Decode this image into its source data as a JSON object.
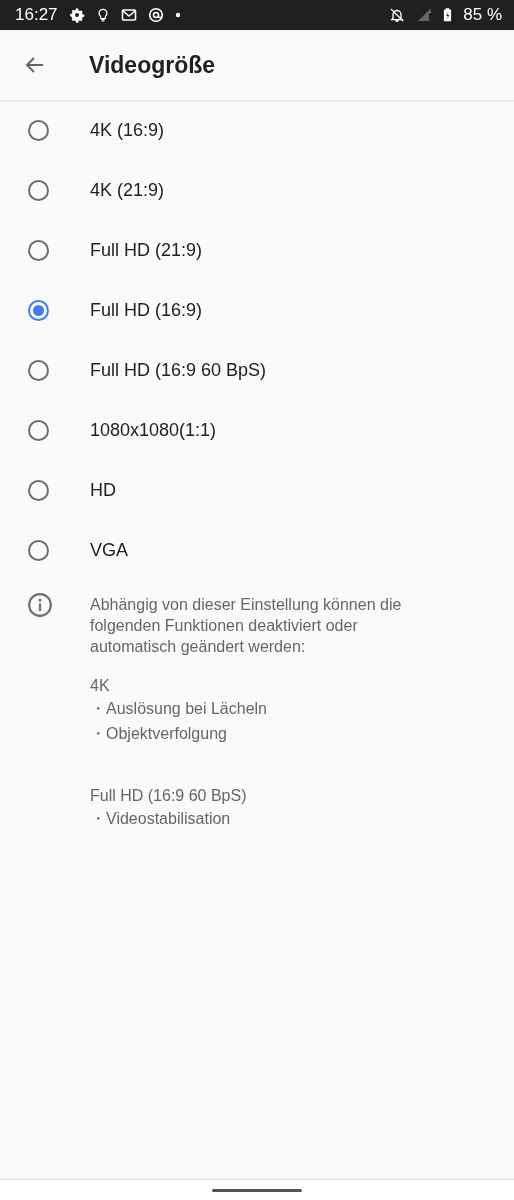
{
  "status_bar": {
    "time": "16:27",
    "battery": "85 %"
  },
  "app_bar": {
    "title": "Videogröße"
  },
  "options": [
    {
      "label": "4K (16:9)",
      "selected": false
    },
    {
      "label": "4K (21:9)",
      "selected": false
    },
    {
      "label": "Full HD (21:9)",
      "selected": false
    },
    {
      "label": "Full HD (16:9)",
      "selected": true
    },
    {
      "label": "Full HD (16:9 60 BpS)",
      "selected": false
    },
    {
      "label": "1080x1080(1:1)",
      "selected": false
    },
    {
      "label": "HD",
      "selected": false
    },
    {
      "label": "VGA",
      "selected": false
    }
  ],
  "info": {
    "text": "Abhängig von dieser Einstellung können die folgenden Funktionen deaktiviert oder automatisch geändert werden:",
    "groups": [
      {
        "heading": "4K",
        "items": [
          "・Auslösung bei Lächeln",
          "・Objektverfolgung"
        ]
      },
      {
        "heading": "Full HD (16:9 60 BpS)",
        "items": [
          "・Videostabilisation"
        ]
      }
    ]
  }
}
